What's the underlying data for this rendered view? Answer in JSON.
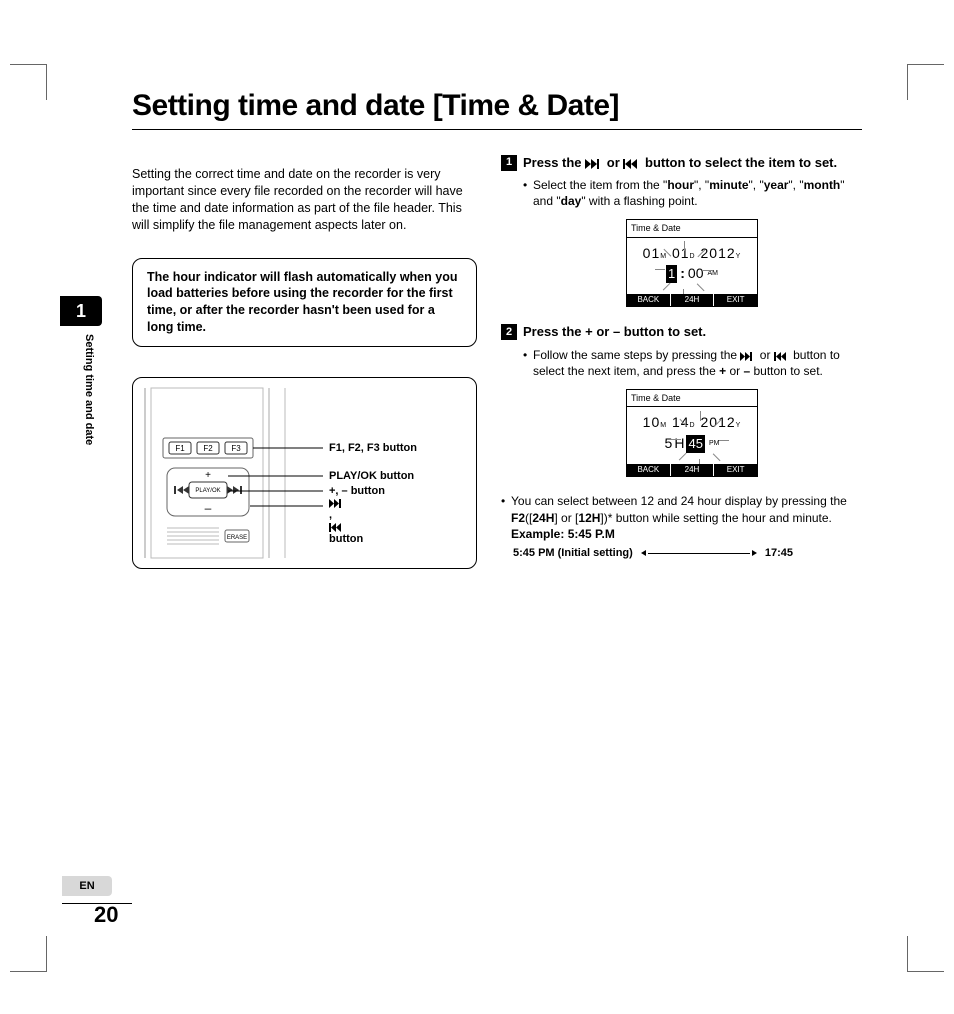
{
  "title": "Setting time and date [Time & Date]",
  "side_chapter": "1",
  "side_label": "Setting time and date",
  "lang_tab": "EN",
  "page_number": "20",
  "intro": "Setting the correct time and date on the recorder is very important since every file recorded on the recorder will have the time and date information as part of the file header. This will simplify the file management aspects later on.",
  "note": "The hour indicator will flash automatically when you load batteries before using the recorder for the first time, or after the recorder hasn't been used for a long time.",
  "device": {
    "f_keys": [
      "F1",
      "F2",
      "F3"
    ],
    "play_ok": "PLAY/OK",
    "erase": "ERASE",
    "callouts": {
      "f": "F1, F2, F3 button",
      "play": "PLAY/OK button",
      "plusminus": "+, – button",
      "nav": "▶▶|, |◀◀ button"
    }
  },
  "steps": [
    {
      "num": "1",
      "head_pre": "Press the ",
      "head_mid": " or ",
      "head_post": " button to select the item to set.",
      "bullet_pre": "Select the item from the \"",
      "bold1": "hour",
      "mid1": "\", \"",
      "bold2": "minute",
      "mid2": "\", \"",
      "bold3": "year",
      "mid3": "\", \"",
      "bold4": "month",
      "mid4": "\" and \"",
      "bold5": "day",
      "mid5": "\" with a flashing point.",
      "lcd": {
        "title": "Time & Date",
        "month": "01",
        "day": "01",
        "year": "2012",
        "m": "M",
        "d": "D",
        "y": "Y",
        "hour_blink": "1",
        "minute": "00",
        "ampm": "AM",
        "soft": [
          "BACK",
          "24H",
          "EXIT"
        ]
      }
    },
    {
      "num": "2",
      "head": "Press the + or – button to set.",
      "bullet_pre": "Follow the same steps by pressing the ",
      "bullet_mid": " or ",
      "bullet_post1": " button to select the next item, and press the ",
      "bold_plus": "+",
      "bullet_post2": " or ",
      "bold_minus": "–",
      "bullet_post3": " button to set.",
      "lcd": {
        "title": "Time & Date",
        "month": "10",
        "day": "14",
        "year": "2012",
        "m": "M",
        "d": "D",
        "y": "Y",
        "hour": "5",
        "h_label": "H",
        "min_blink": "45",
        "pm": "PM",
        "soft": [
          "BACK",
          "24H",
          "EXIT"
        ]
      },
      "note2_pre": "You can select between 12 and 24 hour display by pressing the ",
      "note2_f2": "F2",
      "note2_b24": "24H",
      "note2_b12": "12H",
      "note2_post": "])* button while setting the hour and minute.",
      "example_label": "Example: 5:45 P.M",
      "example_left": "5:45 PM (Initial setting)",
      "example_right": "17:45"
    }
  ]
}
